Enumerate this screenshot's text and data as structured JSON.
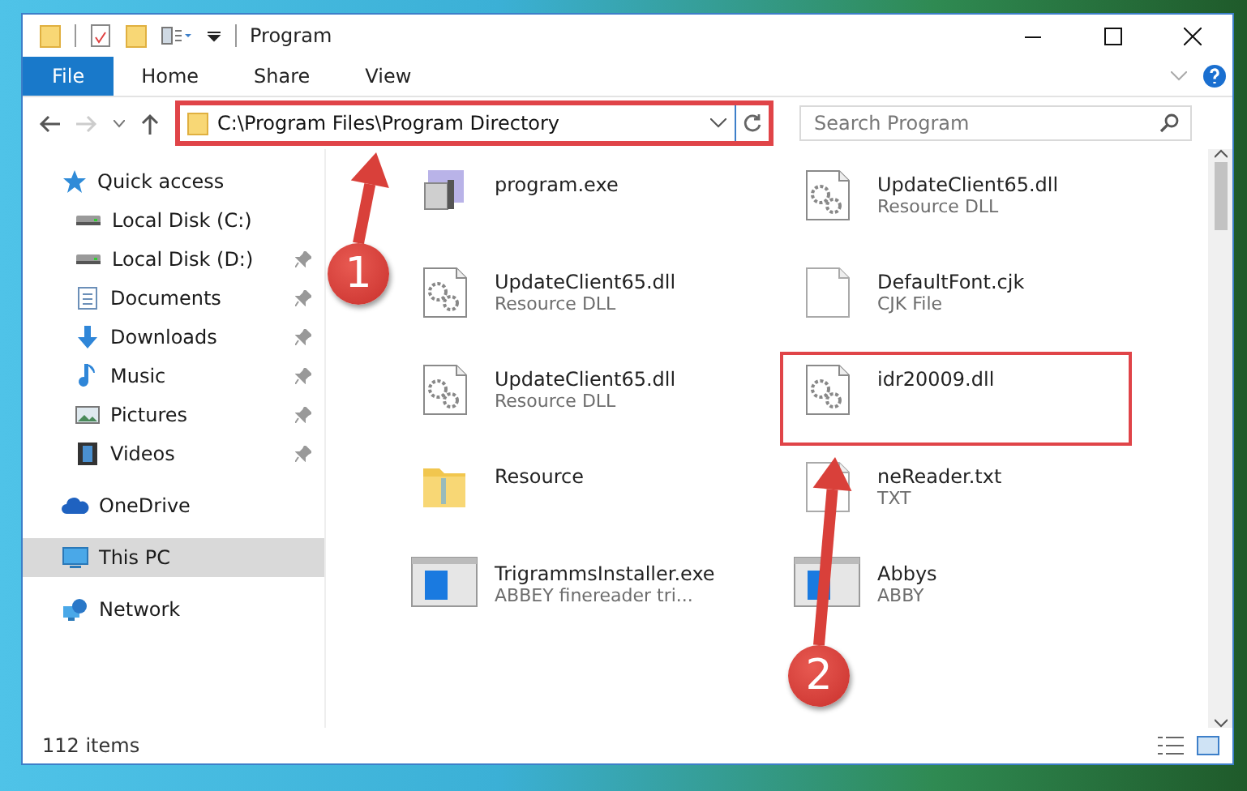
{
  "window": {
    "title": "Program"
  },
  "ribbon_tabs": [
    {
      "label": "File",
      "selected": true
    },
    {
      "label": "Home",
      "selected": false
    },
    {
      "label": "Share",
      "selected": false
    },
    {
      "label": "View",
      "selected": false
    }
  ],
  "address_bar": {
    "path": "C:\\Program Files\\Program Directory",
    "highlighted": true
  },
  "search": {
    "placeholder": "Search Program"
  },
  "sidebar": {
    "items": [
      {
        "label": "Quick access",
        "kind": "star",
        "selected": false,
        "children": [
          {
            "label": "Local Disk (C:)",
            "kind": "drive",
            "pinned": false,
            "selected": false
          },
          {
            "label": "Local Disk (D:)",
            "kind": "drive",
            "pinned": true,
            "selected": false
          },
          {
            "label": "Documents",
            "kind": "document",
            "pinned": true,
            "selected": false
          },
          {
            "label": "Downloads",
            "kind": "download",
            "pinned": true,
            "selected": false
          },
          {
            "label": "Music",
            "kind": "music",
            "pinned": true,
            "selected": false
          },
          {
            "label": "Pictures",
            "kind": "picture",
            "pinned": true,
            "selected": false
          },
          {
            "label": "Videos",
            "kind": "video",
            "pinned": true,
            "selected": false
          }
        ]
      },
      {
        "label": "OneDrive",
        "kind": "cloud",
        "selected": false
      },
      {
        "label": "This PC",
        "kind": "monitor",
        "selected": true
      },
      {
        "label": "Network",
        "kind": "network",
        "selected": false
      }
    ]
  },
  "files": [
    {
      "name": "program.exe",
      "kind": "app",
      "highlighted": false
    },
    {
      "name": "UpdateClient65.dll",
      "type": "Resource DLL",
      "kind": "dll",
      "highlighted": false
    },
    {
      "name": "UpdateClient65.dll",
      "type": "Resource DLL",
      "kind": "dll",
      "highlighted": false
    },
    {
      "name": "DefaultFont.cjk",
      "type": "CJK File",
      "kind": "blank",
      "highlighted": false
    },
    {
      "name": "UpdateClient65.dll",
      "type": "Resource DLL",
      "kind": "dll",
      "highlighted": false
    },
    {
      "name": "idr20009.dll",
      "kind": "dll",
      "highlighted": true
    },
    {
      "name": "Resource",
      "kind": "folder",
      "highlighted": false
    },
    {
      "name": "neReader.txt",
      "type": "TXT",
      "kind": "blank",
      "highlighted": false
    },
    {
      "name": "TrigrammsInstaller.exe",
      "type": "ABBEY finereader tri...",
      "kind": "installer",
      "highlighted": false
    },
    {
      "name": "Abbys",
      "type": "ABBY",
      "kind": "installer",
      "highlighted": false
    }
  ],
  "status_bar": {
    "count": "112 items"
  },
  "annotations": [
    {
      "number": "1"
    },
    {
      "number": "2"
    }
  ]
}
